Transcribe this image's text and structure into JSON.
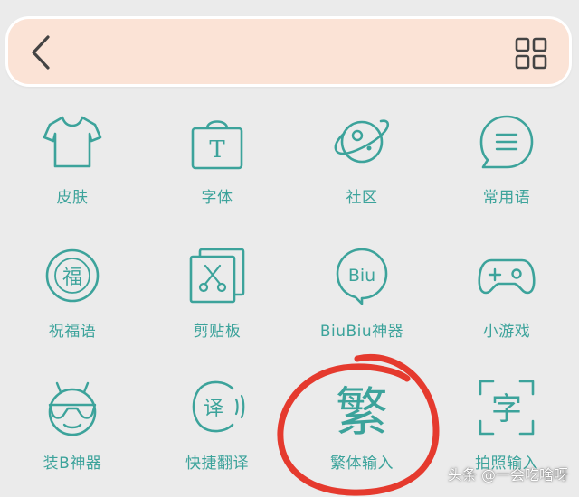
{
  "colors": {
    "accent": "#3ca39b",
    "toolbar_bg": "#fbe3d6",
    "page_bg": "#ebebeb",
    "annotation": "#e53a2e"
  },
  "toolbar": {
    "back_icon": "chevron-left-icon",
    "menu_icon": "grid-icon"
  },
  "grid": {
    "items": [
      {
        "label": "皮肤",
        "icon": "tshirt-icon"
      },
      {
        "label": "字体",
        "icon": "font-bag-icon",
        "glyph": "T"
      },
      {
        "label": "社区",
        "icon": "planet-icon"
      },
      {
        "label": "常用语",
        "icon": "chat-bubble-icon"
      },
      {
        "label": "祝福语",
        "icon": "blessing-icon",
        "glyph": "福"
      },
      {
        "label": "剪贴板",
        "icon": "clipboard-scissors-icon"
      },
      {
        "label": "BiuBiu神器",
        "icon": "biu-bubble-icon",
        "glyph": "Biu"
      },
      {
        "label": "小游戏",
        "icon": "gamepad-icon"
      },
      {
        "label": "装B神器",
        "icon": "cool-face-icon"
      },
      {
        "label": "快捷翻译",
        "icon": "translate-icon",
        "glyph": "译"
      },
      {
        "label": "繁体输入",
        "icon": "traditional-chinese-icon",
        "glyph": "繁"
      },
      {
        "label": "拍照输入",
        "icon": "scan-text-icon",
        "glyph": "字"
      }
    ]
  },
  "watermark": "头条 @一会吃啥呀"
}
